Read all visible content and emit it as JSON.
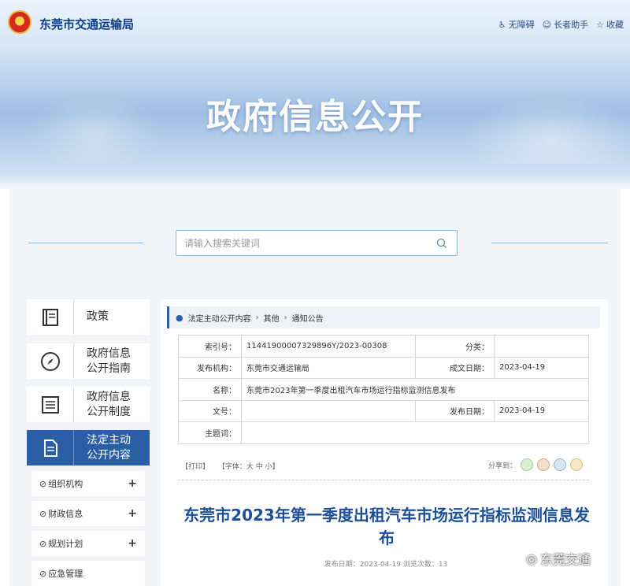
{
  "header": {
    "site_title": "东莞市交通运输局",
    "tools": [
      "无障碍",
      "长者助手",
      "收藏"
    ]
  },
  "banner": {
    "title": "政府信息公开"
  },
  "search": {
    "placeholder": "请输入搜索关键词"
  },
  "sidebar": {
    "items": [
      {
        "label": "政策",
        "icon": "book-icon"
      },
      {
        "label": "政府信息\n公开指南",
        "icon": "compass-icon"
      },
      {
        "label": "政府信息\n公开制度",
        "icon": "list-document-icon"
      },
      {
        "label": "法定主动\n公开内容",
        "icon": "document-icon",
        "active": true
      }
    ],
    "sub_items": [
      "组织机构",
      "财政信息",
      "规划计划",
      "应急管理"
    ]
  },
  "breadcrumb": [
    "法定主动公开内容",
    "其他",
    "通知公告"
  ],
  "meta": {
    "index_label": "索引号：",
    "index_value": "11441900007329896Y/2023-00308",
    "category_label": "分类：",
    "category_value": "",
    "publisher_label": "发布机构：",
    "publisher_value": "东莞市交通运输局",
    "created_label": "成文日期：",
    "created_value": "2023-04-19",
    "name_label": "名称：",
    "name_value": "东莞市2023年第一季度出租汽车市场运行指标监测信息发布",
    "docno_label": "文号：",
    "docno_value": "",
    "published_label": "发布日期：",
    "published_value": "2023-04-19",
    "keywords_label": "主题词：",
    "keywords_value": ""
  },
  "article_tools": {
    "print": "【打印】",
    "font": "【字体：大  中  小】",
    "share_label": "分享到："
  },
  "article": {
    "title": "东莞市2023年第一季度出租汽车市场运行指标监测信息发布",
    "meta": "发布日期：2023-04-19   浏览次数：13"
  },
  "watermark": "东莞交通",
  "colors": {
    "accent": "#2a5fa6",
    "title_blue": "#1c4f97",
    "brand_dark": "#0d3d86"
  }
}
